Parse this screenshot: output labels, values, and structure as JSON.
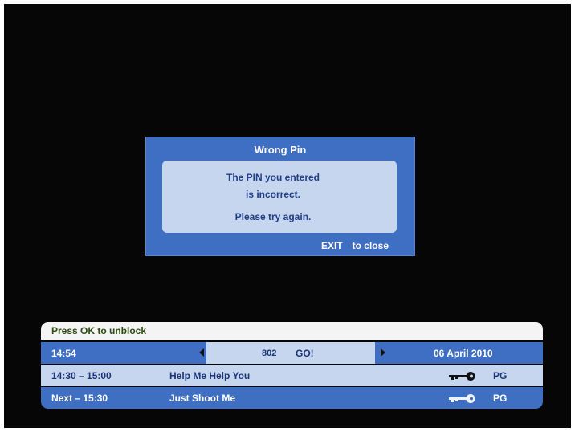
{
  "dialog": {
    "title": "Wrong Pin",
    "line1": "The PIN you entered",
    "line2": "is incorrect.",
    "line3": "Please try again.",
    "exit_key": "EXIT",
    "exit_label": "to close"
  },
  "info_bar": {
    "unblock_prompt": "Press OK to unblock",
    "clock": "14:54",
    "channel_number": "802",
    "channel_name": "GO!",
    "date": "06 April 2010",
    "now": {
      "time": "14:30 – 15:00",
      "title": "Help Me Help You",
      "rating": "PG",
      "icon": "key-icon"
    },
    "next": {
      "time": "Next – 15:30",
      "title": "Just Shoot Me",
      "rating": "PG",
      "icon": "key-icon"
    }
  },
  "colors": {
    "screen_bg": "#060606",
    "panel_blue": "#3f6fc2",
    "panel_light": "#c7d6ef",
    "text_dark_blue": "#1c3577"
  }
}
